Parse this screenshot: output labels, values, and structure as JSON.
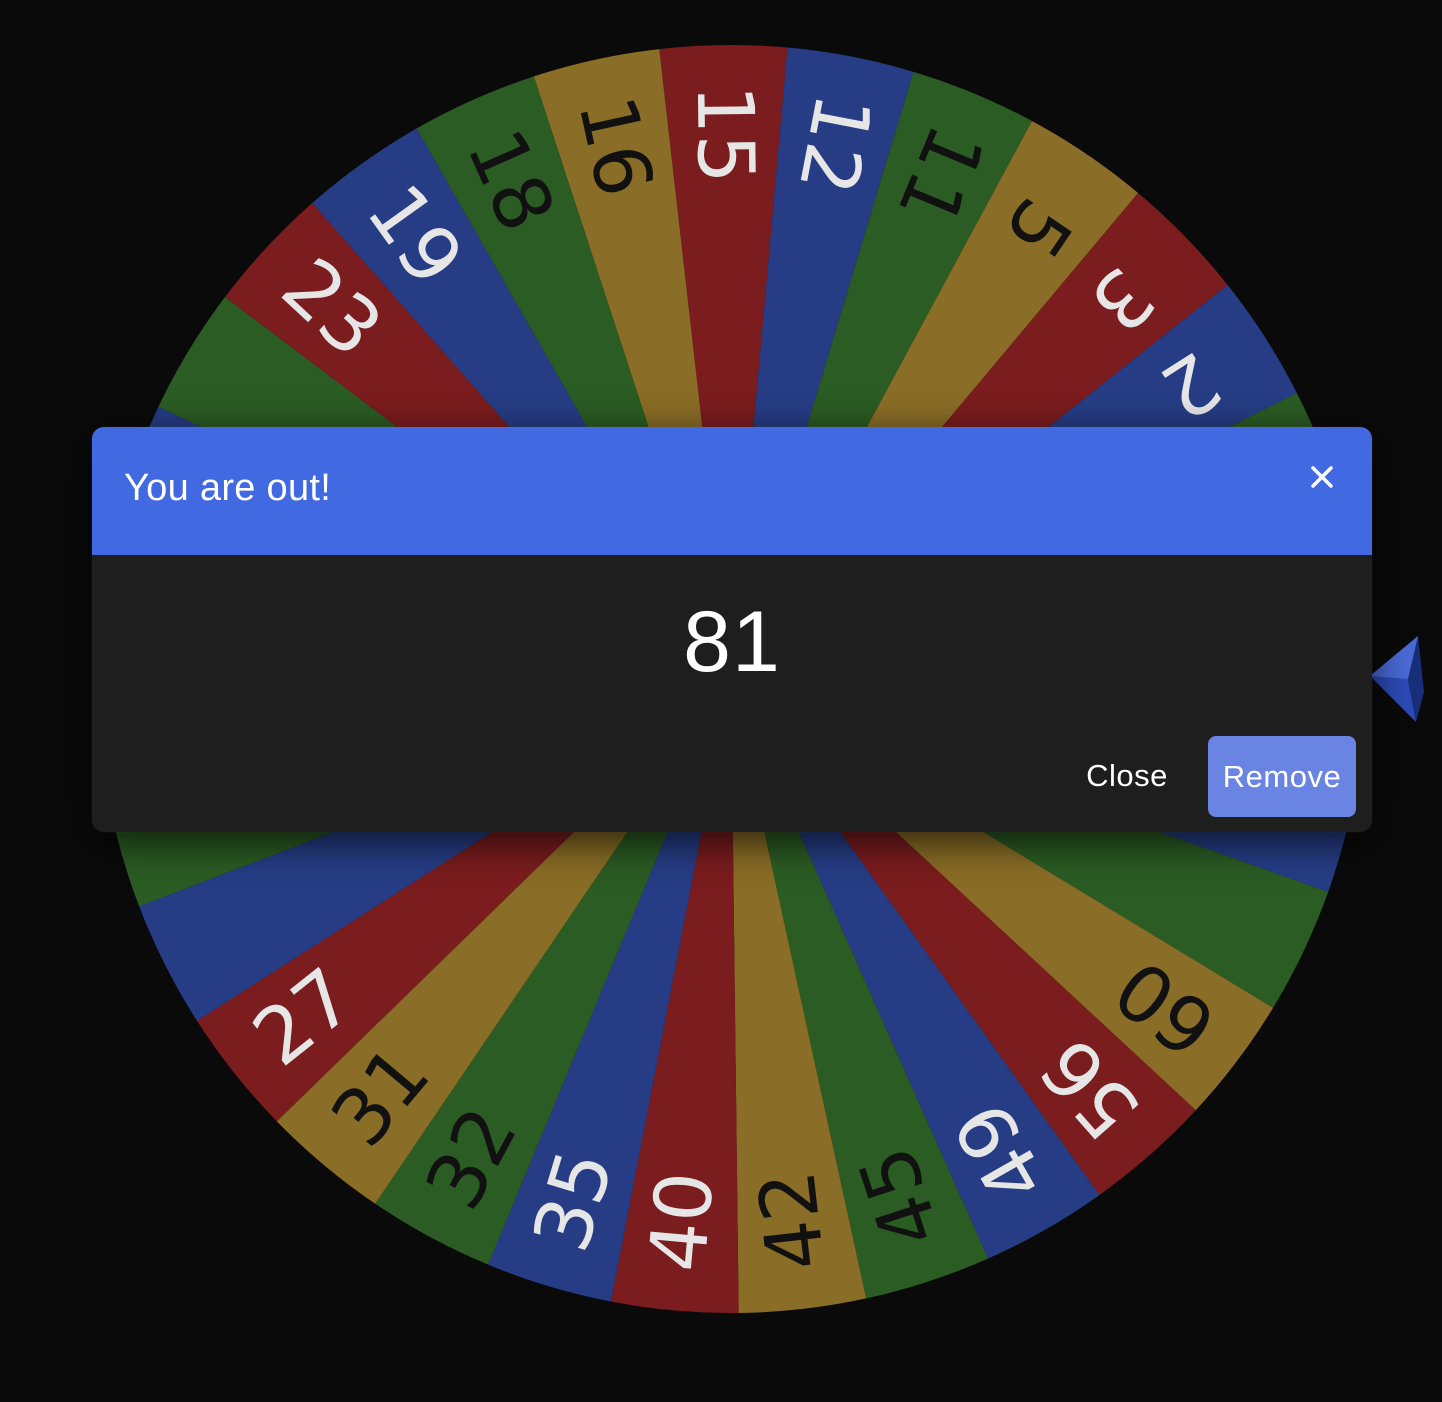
{
  "wheel": {
    "segments": [
      {
        "label": "15",
        "color": "#7b1c1e",
        "text_color": "#e6e6e6"
      },
      {
        "label": "12",
        "color": "#263d86",
        "text_color": "#e6e6e6"
      },
      {
        "label": "11",
        "color": "#2b5c23",
        "text_color": "#111111"
      },
      {
        "label": "5",
        "color": "#8a6d26",
        "text_color": "#111111"
      },
      {
        "label": "3",
        "color": "#7b1c1e",
        "text_color": "#e6e6e6"
      },
      {
        "label": "2",
        "color": "#263d86",
        "text_color": "#e6e6e6"
      },
      {
        "label": "",
        "color": "#2b5c23",
        "text_color": "#111111"
      },
      {
        "label": "",
        "color": "#8a6d26",
        "text_color": "#111111"
      },
      {
        "label": "",
        "color": "#7b1c1e",
        "text_color": "#e6e6e6"
      },
      {
        "label": "",
        "color": "#263d86",
        "text_color": "#e6e6e6"
      },
      {
        "label": "",
        "color": "#2b5c23",
        "text_color": "#111111"
      },
      {
        "label": "60",
        "color": "#8a6d26",
        "text_color": "#111111"
      },
      {
        "label": "56",
        "color": "#7b1c1e",
        "text_color": "#e6e6e6"
      },
      {
        "label": "49",
        "color": "#263d86",
        "text_color": "#e6e6e6"
      },
      {
        "label": "45",
        "color": "#2b5c23",
        "text_color": "#111111"
      },
      {
        "label": "42",
        "color": "#8a6d26",
        "text_color": "#111111"
      },
      {
        "label": "40",
        "color": "#7b1c1e",
        "text_color": "#e6e6e6"
      },
      {
        "label": "35",
        "color": "#263d86",
        "text_color": "#e6e6e6"
      },
      {
        "label": "32",
        "color": "#2b5c23",
        "text_color": "#111111"
      },
      {
        "label": "31",
        "color": "#8a6d26",
        "text_color": "#111111"
      },
      {
        "label": "27",
        "color": "#7b1c1e",
        "text_color": "#e6e6e6"
      },
      {
        "label": "",
        "color": "#263d86",
        "text_color": "#e6e6e6"
      },
      {
        "label": "",
        "color": "#2b5c23",
        "text_color": "#111111"
      },
      {
        "label": "",
        "color": "#8a6d26",
        "text_color": "#111111"
      },
      {
        "label": "",
        "color": "#7b1c1e",
        "text_color": "#e6e6e6"
      },
      {
        "label": "",
        "color": "#263d86",
        "text_color": "#e6e6e6"
      },
      {
        "label": "",
        "color": "#2b5c23",
        "text_color": "#111111"
      },
      {
        "label": "23",
        "color": "#7b1c1e",
        "text_color": "#e6e6e6"
      },
      {
        "label": "19",
        "color": "#263d86",
        "text_color": "#e6e6e6"
      },
      {
        "label": "18",
        "color": "#2b5c23",
        "text_color": "#111111"
      },
      {
        "label": "16",
        "color": "#8a6d26",
        "text_color": "#111111"
      }
    ],
    "pointer_color": "#2c4bb8"
  },
  "dialog": {
    "title": "You are out!",
    "close_icon": "close-icon",
    "result": "81",
    "close_label": "Close",
    "remove_label": "Remove",
    "header_color": "#4169e1",
    "remove_color": "#6a84e4"
  }
}
